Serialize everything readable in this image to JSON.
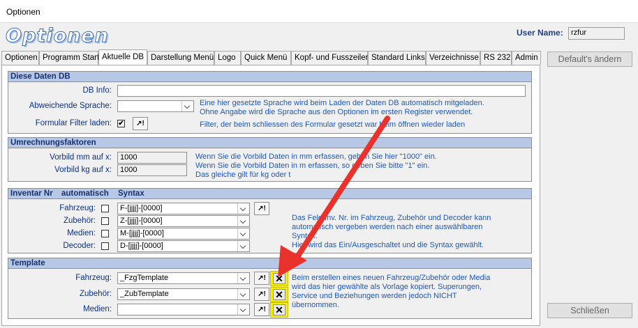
{
  "window": {
    "title": "Optionen"
  },
  "header": {
    "app_title": "Optionen",
    "user_label": "User Name:",
    "user_value": "rzfur"
  },
  "tabs": [
    {
      "label": "Optionen"
    },
    {
      "label": "Programm Start"
    },
    {
      "label": "Aktuelle DB"
    },
    {
      "label": "Darstellung Menü"
    },
    {
      "label": "Logo"
    },
    {
      "label": "Quick Menü"
    },
    {
      "label": "Kopf- und Fusszeilen"
    },
    {
      "label": "Standard Links"
    },
    {
      "label": "Verzeichnisse"
    },
    {
      "label": "RS 232"
    },
    {
      "label": "Admin"
    }
  ],
  "db": {
    "header": "Diese Daten DB",
    "db_info_label": "DB Info:",
    "db_info_value": "",
    "lang_label": "Abweichende Sprache:",
    "lang_value": "",
    "lang_note_1": "Eine hier gesetzte Sprache wird beim Laden der Daten DB automatisch mitgeladen.",
    "lang_note_2": "Ohne Angabe wird die Sprache aus den Optionen im ersten Register verwendet.",
    "filter_label": "Formular Filter laden:",
    "filter_checked": "✔",
    "filter_note": "Filter, der beim schliessen des Formular gesetzt war beim öffnen wieder laden"
  },
  "conv": {
    "header": "Umrechnungsfaktoren",
    "mm_label": "Vorbild mm auf x:",
    "mm_value": "1000",
    "kg_label": "Vorbild kg auf x:",
    "kg_value": "1000",
    "note_1": "Wenn Sie die Vorbild Daten in mm erfassen, geben Sie hier \"1000\" ein.",
    "note_2": "Wenn Sie die Vorbild Daten in m erfassen, so geben Sie bitte \"1\" ein.",
    "note_3": "Das gleiche gilt für kg oder t"
  },
  "inv": {
    "header": "Inventar Nr",
    "col_auto": "automatisch",
    "col_syntax": "Syntax",
    "rows": [
      {
        "label": "Fahrzeug:",
        "value": "F-[jjjj]-[0000]"
      },
      {
        "label": "Zubehör:",
        "value": "Z-[jjjj]-[0000]"
      },
      {
        "label": "Medien:",
        "value": "M-[jjjj]-[0000]"
      },
      {
        "label": "Decoder:",
        "value": "D-[jjjj]-[0000]"
      }
    ],
    "note_1": "Das Feld Inv. Nr. im Fahrzeug, Zubehör und Decoder kann",
    "note_2": "automatisch vergeben werden nach einer auswählbaren",
    "note_3": "Syntax.",
    "note_4": "Hier wird das Ein/Ausgeschaltet und die Syntax gewählt."
  },
  "tpl": {
    "header": "Template",
    "rows": [
      {
        "label": "Fahrzeug:",
        "value": "_FzgTemplate"
      },
      {
        "label": "Zubehör:",
        "value": "_ZubTemplate"
      },
      {
        "label": "Medien:",
        "value": ""
      }
    ],
    "note_1": "Beim erstellen eines neuen Fahrzeug/Zubehör oder Media",
    "note_2": "wird das hier gewählte als Vorlage kopiert. Superungen,",
    "note_3": "Service und Beziehungen werden jedoch NICHT",
    "note_4": "übernommen."
  },
  "buttons": {
    "defaults": "Default's ändern",
    "close": "Schließen",
    "wand": "↗!",
    "clear": "✕"
  },
  "annotation": {
    "arrow_color": "#e8322b",
    "highlight_color": "#f6f000"
  }
}
